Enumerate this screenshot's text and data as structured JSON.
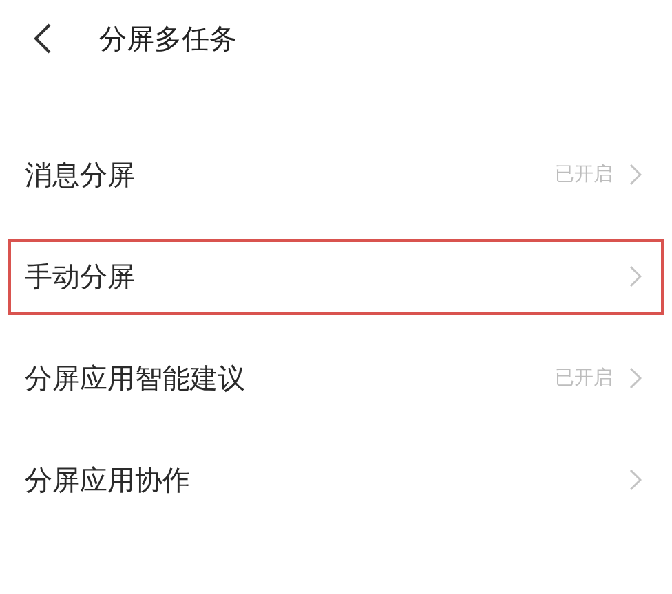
{
  "header": {
    "back_icon": true,
    "title": "分屏多任务"
  },
  "items": [
    {
      "label": "消息分屏",
      "status": "已开启",
      "highlighted": false
    },
    {
      "label": "手动分屏",
      "highlighted": true
    },
    {
      "label": "分屏应用智能建议",
      "status": "已开启",
      "highlighted": false
    },
    {
      "label": "分屏应用协作",
      "highlighted": false
    }
  ]
}
